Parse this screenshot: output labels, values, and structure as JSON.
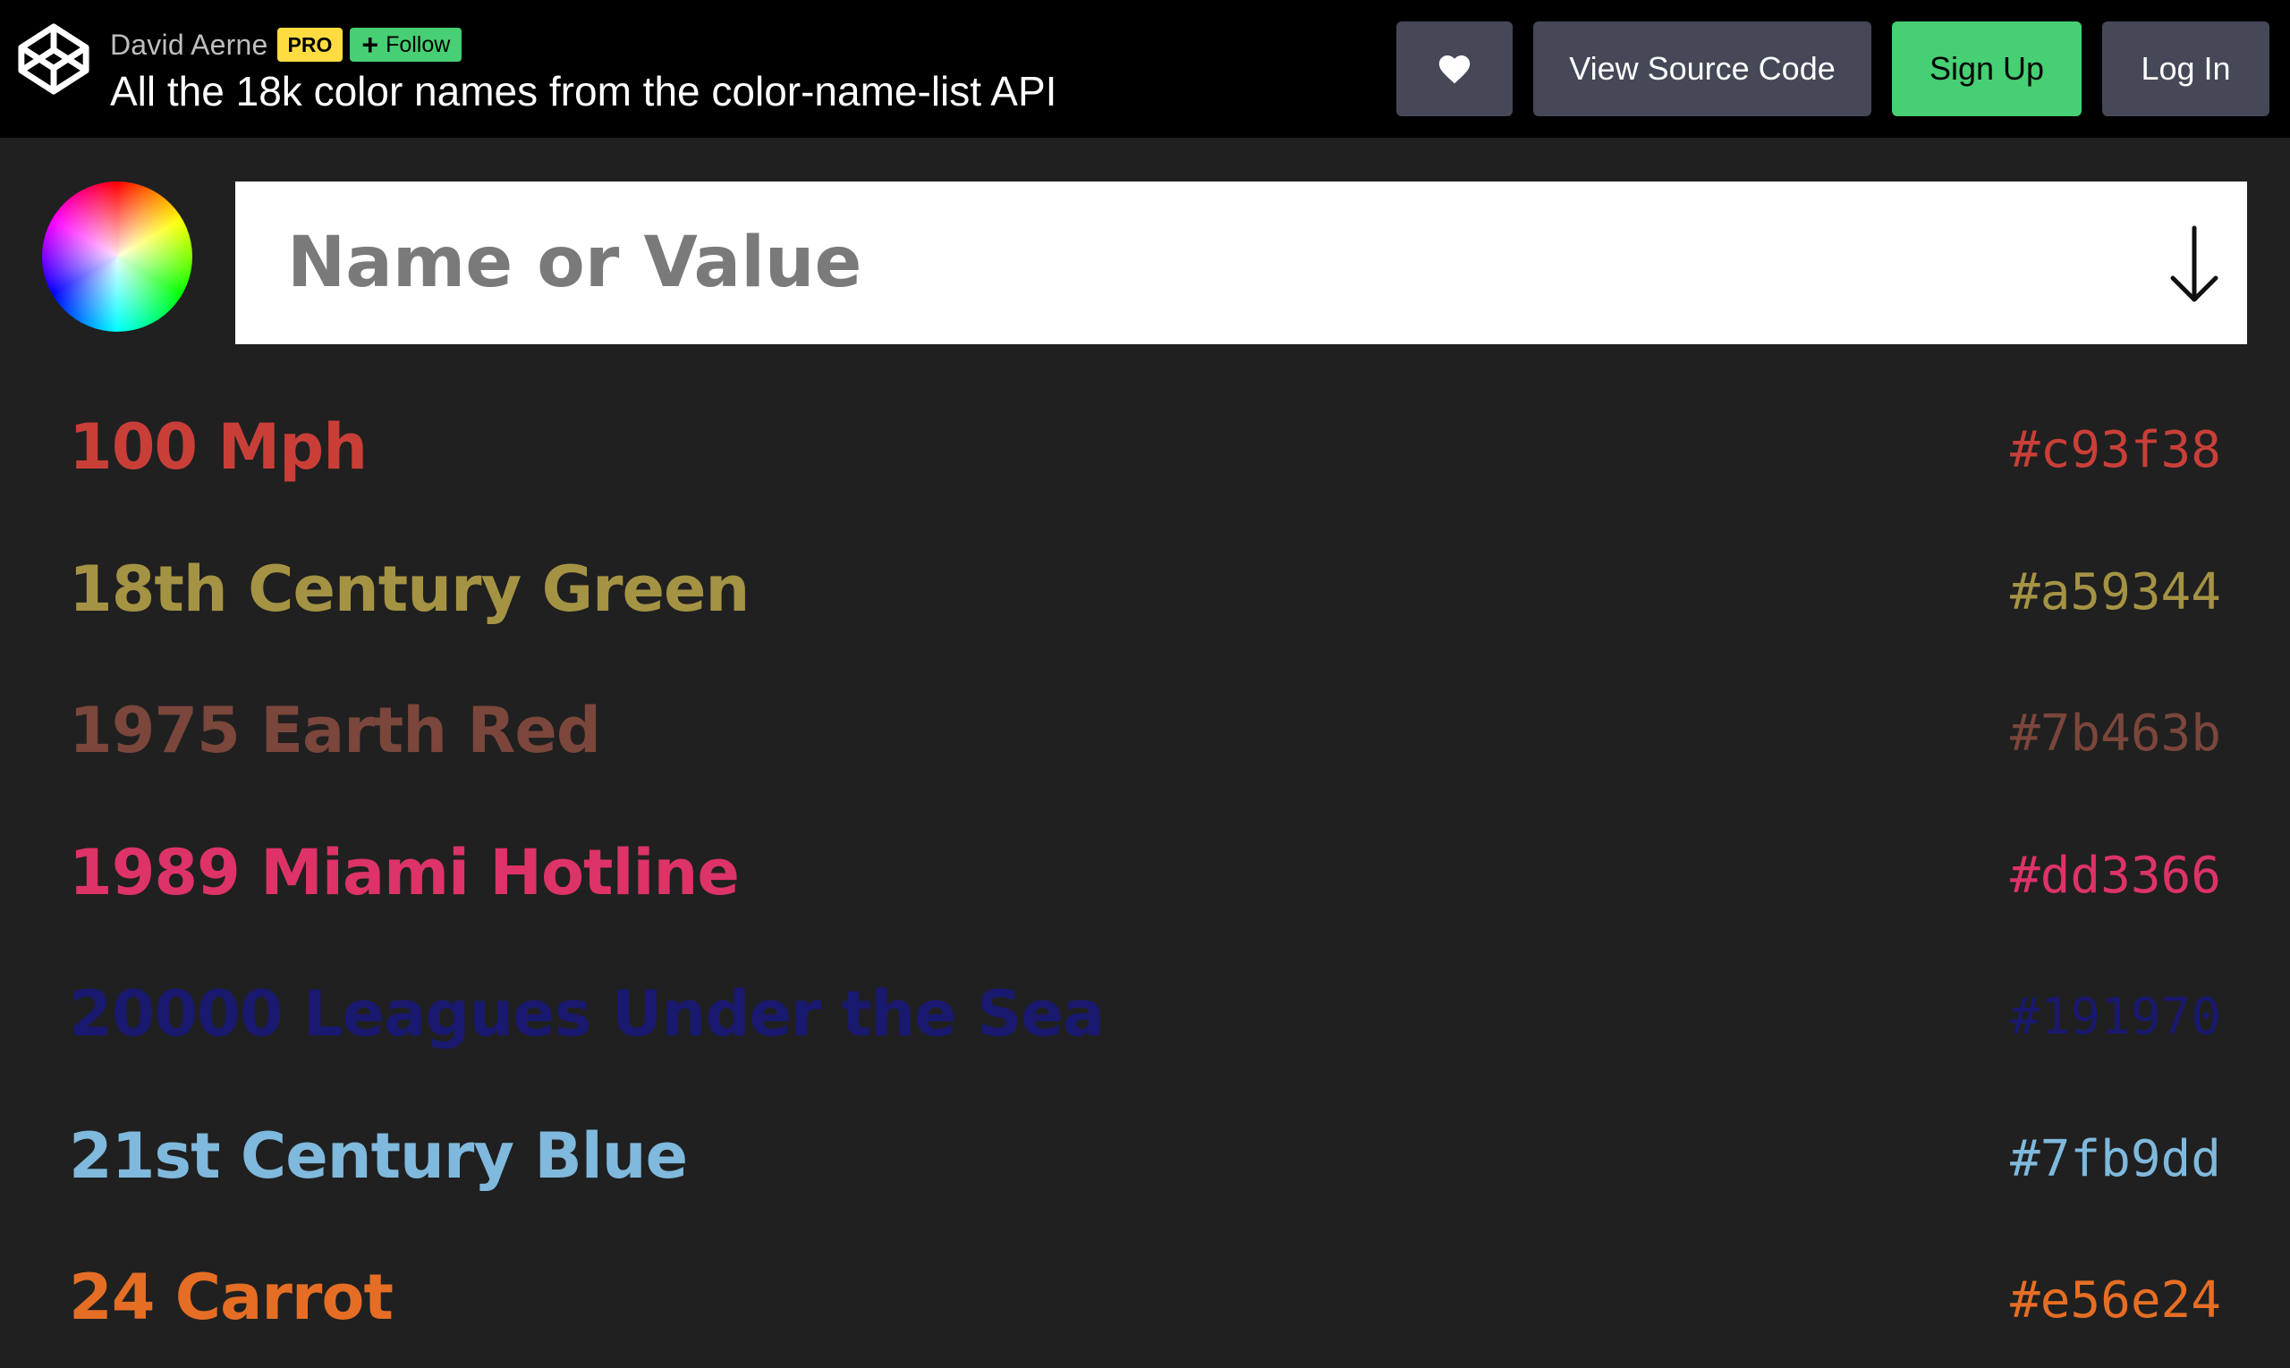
{
  "header": {
    "author": "David Aerne",
    "pro_badge": "PRO",
    "follow_label": "Follow",
    "title": "All the 18k color names from the color-name-list API",
    "source_label": "View Source Code",
    "signup_label": "Sign Up",
    "login_label": "Log In"
  },
  "search": {
    "placeholder": "Name or Value"
  },
  "colors": [
    {
      "name": "100 Mph",
      "hex": "#c93f38"
    },
    {
      "name": "18th Century Green",
      "hex": "#a59344"
    },
    {
      "name": "1975 Earth Red",
      "hex": "#7b463b"
    },
    {
      "name": "1989 Miami Hotline",
      "hex": "#dd3366"
    },
    {
      "name": "20000 Leagues Under the Sea",
      "hex": "#191970"
    },
    {
      "name": "21st Century Blue",
      "hex": "#7fb9dd"
    },
    {
      "name": "24 Carrot",
      "hex": "#e56e24"
    }
  ],
  "theme": {
    "topbar": "#000000",
    "background": "#202020",
    "signup_green": "#47cf73",
    "pro_yellow": "#ffdd40",
    "button_gray": "#444857"
  },
  "icons": {
    "logo": "codepen-logo-icon",
    "heart": "heart-icon",
    "wheel": "color-wheel-icon",
    "arrow": "arrow-down-icon"
  }
}
